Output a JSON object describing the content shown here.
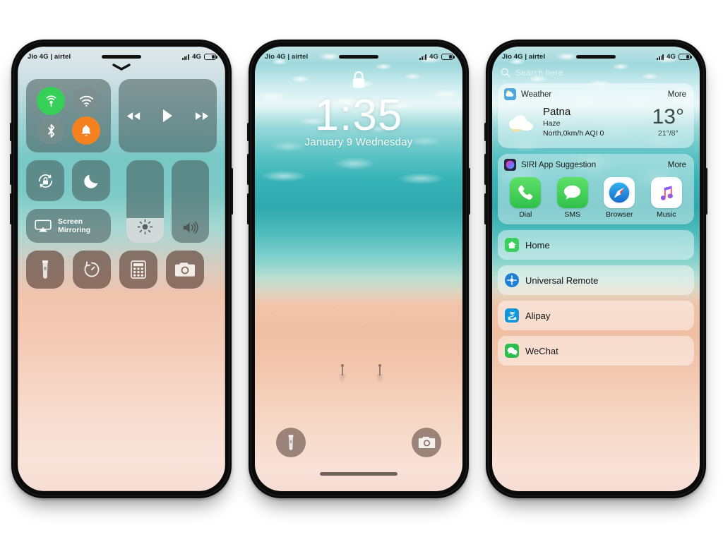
{
  "colors": {
    "green": "#36d058",
    "orange": "#f5821f",
    "frame": "#0a0a0a",
    "tile": "rgba(70,88,88,0.55)",
    "app_brown": "rgba(105,78,66,0.72)"
  },
  "status_bar": {
    "carrier": "Jio 4G | airtel",
    "network": "4G",
    "signal_icon": "signal-bars-icon",
    "battery_icon": "battery-icon"
  },
  "phone1": {
    "name": "Control Center",
    "notch_icon": "speaker-pill-icon",
    "chevron_icon": "chevron-down-icon",
    "toggles": [
      {
        "name": "airplane-mode",
        "icon": "airplane-signal-icon",
        "state": "on"
      },
      {
        "name": "wifi",
        "icon": "wifi-icon",
        "state": "off"
      },
      {
        "name": "bluetooth",
        "icon": "bluetooth-icon",
        "state": "off"
      },
      {
        "name": "ringer",
        "icon": "bell-icon",
        "state": "on"
      }
    ],
    "media": [
      {
        "name": "previous",
        "icon": "rewind-icon"
      },
      {
        "name": "play",
        "icon": "play-icon"
      },
      {
        "name": "next",
        "icon": "fast-forward-icon"
      }
    ],
    "small_tiles": [
      {
        "name": "rotation-lock",
        "icon": "rotation-lock-icon"
      },
      {
        "name": "do-not-disturb",
        "icon": "moon-icon"
      }
    ],
    "screen_mirroring": {
      "label_line1": "Screen",
      "label_line2": "Mirroring",
      "icon": "airplay-icon"
    },
    "sliders": [
      {
        "name": "brightness",
        "icon": "brightness-icon",
        "fill_percent": 30
      },
      {
        "name": "volume",
        "icon": "volume-icon",
        "fill_percent": 0
      }
    ],
    "shortcuts": [
      {
        "name": "flashlight",
        "icon": "flashlight-icon"
      },
      {
        "name": "timer",
        "icon": "timer-icon"
      },
      {
        "name": "calculator",
        "icon": "calculator-icon"
      },
      {
        "name": "camera",
        "icon": "camera-icon"
      }
    ]
  },
  "phone2": {
    "name": "Lock Screen",
    "lock_icon": "padlock-icon",
    "time": "1:35",
    "date": "January 9 Wednesday",
    "bottom_buttons": [
      {
        "name": "flashlight",
        "icon": "flashlight-icon"
      },
      {
        "name": "camera",
        "icon": "camera-icon"
      }
    ],
    "home_indicator": "home-bar"
  },
  "phone3": {
    "name": "Home Screen Widgets",
    "search": {
      "placeholder": "Search here",
      "icon": "search-icon"
    },
    "weather_card": {
      "title": "Weather",
      "icon": "weather-app-icon",
      "more": "More",
      "condition_icon": "sun-behind-cloud-icon",
      "city": "Patna",
      "condition": "Haze",
      "wind_aqi": "North,0km/h  AQI 0",
      "temp": "13°",
      "range": "21°/8°"
    },
    "siri_card": {
      "title": "SIRI App Suggestion",
      "icon": "siri-icon",
      "more": "More",
      "apps": [
        {
          "label": "Dial",
          "icon": "phone-icon"
        },
        {
          "label": "SMS",
          "icon": "message-icon"
        },
        {
          "label": "Browser",
          "icon": "compass-icon"
        },
        {
          "label": "Music",
          "icon": "music-note-icon"
        }
      ]
    },
    "list": [
      {
        "label": "Home",
        "icon": "home-app-icon"
      },
      {
        "label": "Universal Remote",
        "icon": "remote-icon"
      },
      {
        "label": "Alipay",
        "icon": "alipay-icon"
      },
      {
        "label": "WeChat",
        "icon": "wechat-icon"
      }
    ]
  }
}
